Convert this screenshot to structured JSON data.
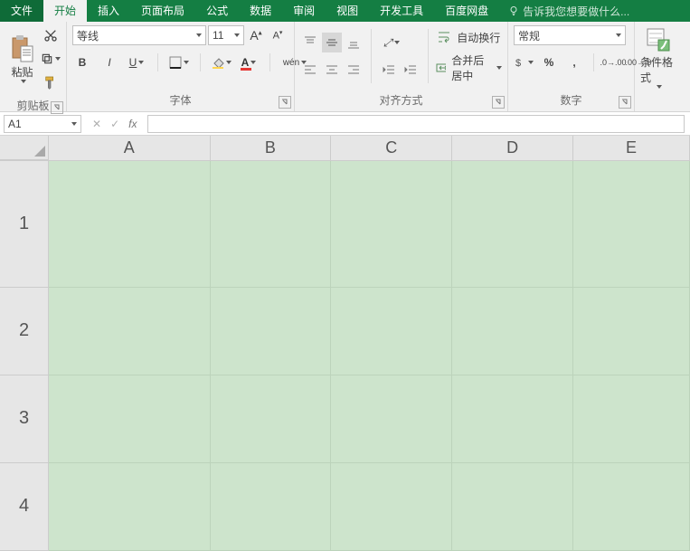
{
  "tabs": {
    "file": "文件",
    "home": "开始",
    "insert": "插入",
    "layout": "页面布局",
    "formula": "公式",
    "data": "数据",
    "review": "审阅",
    "view": "视图",
    "dev": "开发工具",
    "baidu": "百度网盘",
    "tell": "告诉我您想要做什么..."
  },
  "ribbon": {
    "clipboard": {
      "paste": "粘贴",
      "label": "剪贴板"
    },
    "font": {
      "name": "等线",
      "size": "11",
      "wen": "wén",
      "label": "字体"
    },
    "align": {
      "wrap": "自动换行",
      "merge": "合并后居中",
      "label": "对齐方式"
    },
    "number": {
      "format": "常规",
      "label": "数字"
    },
    "styles": {
      "cond": "条件格式"
    }
  },
  "fbar": {
    "cell": "A1"
  },
  "grid": {
    "cols": [
      "A",
      "B",
      "C",
      "D",
      "E"
    ],
    "rows": [
      "1",
      "2",
      "3",
      "4"
    ]
  }
}
